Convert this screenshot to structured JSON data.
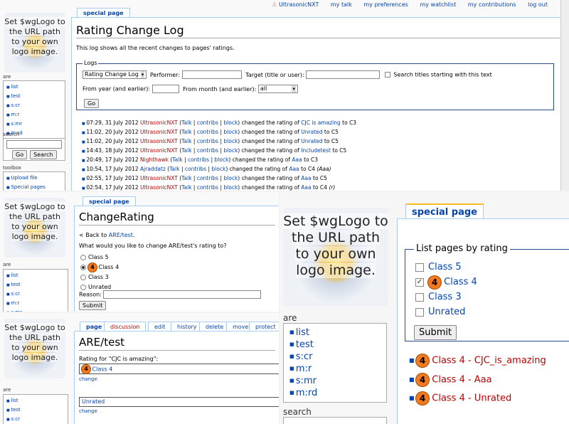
{
  "personal": {
    "user": "UltrasonicNXT",
    "links": [
      "my talk",
      "my preferences",
      "my watchlist",
      "my contributions",
      "log out"
    ]
  },
  "logo_text": "Set $wgLogo to the URL path to your own logo image.",
  "tab_special": "special page",
  "nav_head": "are",
  "nav_items": [
    "list",
    "test",
    "s:cr",
    "m:r",
    "s:mr",
    "m:rd"
  ],
  "search": {
    "head": "search",
    "go": "Go",
    "search": "Search"
  },
  "toolbox": {
    "head": "toolbox",
    "items": [
      "Upload file",
      "Special pages"
    ]
  },
  "p1": {
    "title": "Rating Change Log",
    "intro": "This log shows all the recent changes to pages' ratings.",
    "legend": "Logs",
    "log_select": "Rating Change Log",
    "performer_label": "Performer:",
    "target_label": "Target (title or user):",
    "prefix_label": "Search titles starting with this text",
    "year_label": "From year (and earlier):",
    "month_label": "From month (and earlier):",
    "month_value": "all",
    "go": "Go",
    "entries": [
      {
        "time": "07:29, 31 July 2012",
        "user": "UltrasonicNXT",
        "user_red": true,
        "page": "CJC is amazing",
        "page_red": false,
        "to": "to C3",
        "sum": ""
      },
      {
        "time": "11:02, 20 July 2012",
        "user": "UltrasonicNXT",
        "user_red": true,
        "page": "Unrated",
        "page_red": false,
        "to": "to C5",
        "sum": ""
      },
      {
        "time": "11:02, 20 July 2012",
        "user": "UltrasonicNXT",
        "user_red": true,
        "page": "Unrated",
        "page_red": false,
        "to": "to C5",
        "sum": ""
      },
      {
        "time": "14:43, 18 July 2012",
        "user": "UltrasonicNXT",
        "user_red": true,
        "page": "Includetest",
        "page_red": false,
        "to": "to C5",
        "sum": ""
      },
      {
        "time": "20:49, 17 July 2012",
        "user": "Nighthawk",
        "user_red": true,
        "page": "Aaa",
        "page_red": false,
        "to": "to C3",
        "sum": ""
      },
      {
        "time": "10:54, 17 July 2012",
        "user": "Ajraddatz",
        "user_red": false,
        "page": "Aaa",
        "page_red": false,
        "to": "to C4",
        "sum": "(Aaa)"
      },
      {
        "time": "02:55, 17 July 2012",
        "user": "UltrasonicNXT",
        "user_red": true,
        "page": "Aaa",
        "page_red": false,
        "to": "to C5",
        "sum": ""
      },
      {
        "time": "02:54, 17 July 2012",
        "user": "UltrasonicNXT",
        "user_red": true,
        "page": "Aaa",
        "page_red": false,
        "to": "to C4",
        "sum": "(r)"
      }
    ],
    "talk": "Talk",
    "contribs": "contribs",
    "block": "block",
    "changed": "changed the rating of"
  },
  "p2": {
    "title": "ChangeRating",
    "back_prefix": "< Back to",
    "back_link": "ARE/test",
    "back_suffix": ".",
    "question": "What would you like to change ARE/test's rating to?",
    "options": [
      "Class 5",
      "Class 4",
      "Class 3",
      "Unrated"
    ],
    "selected": 1,
    "reason_label": "Reason:",
    "submit": "Submit"
  },
  "p3": {
    "tabs": [
      "page",
      "discussion",
      "edit",
      "history",
      "delete",
      "move",
      "protect"
    ],
    "title": "ARE/test",
    "rating_for": "Rating for \"CJC is amazing\":",
    "class4": "Class 4",
    "change": "change",
    "unrated": "Unrated",
    "change2": "change"
  },
  "p4": {
    "legend": "List pages by rating",
    "options": [
      "Class 5",
      "Class 4",
      "Class 3",
      "Unrated"
    ],
    "checked": 1,
    "submit": "Submit",
    "results": [
      "Class 4 - CJC_is_amazing",
      "Class 4 - Aaa",
      "Class 4 - Unrated"
    ],
    "search_head": "search"
  },
  "colors": {
    "link": "#0645ad",
    "redlink": "#ba0000",
    "badge": "#f47a1f",
    "border": "#aaccee"
  }
}
